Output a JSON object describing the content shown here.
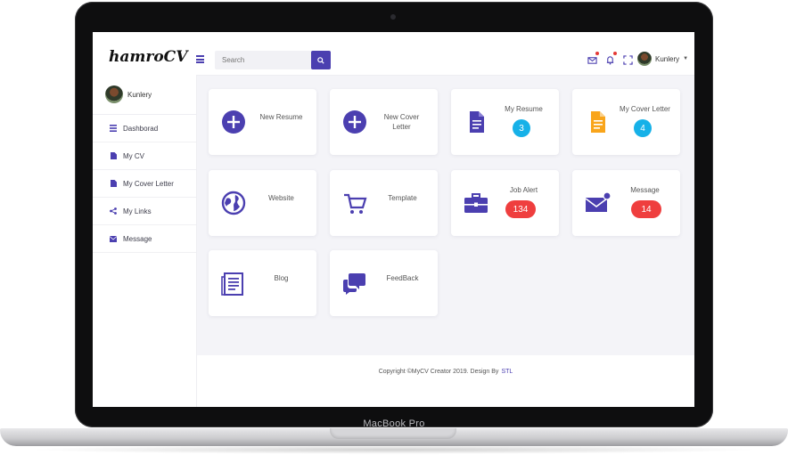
{
  "app": {
    "logo": "hamroCV"
  },
  "search": {
    "placeholder": "Search"
  },
  "user": {
    "name": "Kunlery"
  },
  "sidebar": {
    "items": [
      {
        "label": "Dashborad",
        "icon": "list-icon"
      },
      {
        "label": "My CV",
        "icon": "file-icon"
      },
      {
        "label": "My Cover Letter",
        "icon": "file-icon"
      },
      {
        "label": "My Links",
        "icon": "share-icon"
      },
      {
        "label": "Message",
        "icon": "envelope-icon"
      }
    ]
  },
  "cards": {
    "new_resume": "New Resume",
    "new_cover_letter": "New Cover Letter",
    "my_resume": {
      "label": "My Resume",
      "count": "3"
    },
    "my_cover_letter": {
      "label": "My Cover Letter",
      "count": "4"
    },
    "website": "Website",
    "template": "Template",
    "job_alert": {
      "label": "Job Alert",
      "count": "134"
    },
    "message": {
      "label": "Message",
      "count": "14"
    },
    "blog": "Blog",
    "feedback": "FeedBack"
  },
  "footer": {
    "text": "Copyright ©MyCV Creator 2019. Design By",
    "brand": "STL"
  },
  "device": {
    "label": "MacBook Pro"
  },
  "colors": {
    "accent": "#4b3fb0",
    "badge_blue": "#16b1e8",
    "badge_red": "#ef3e3e",
    "doc_orange": "#f9a51b"
  }
}
